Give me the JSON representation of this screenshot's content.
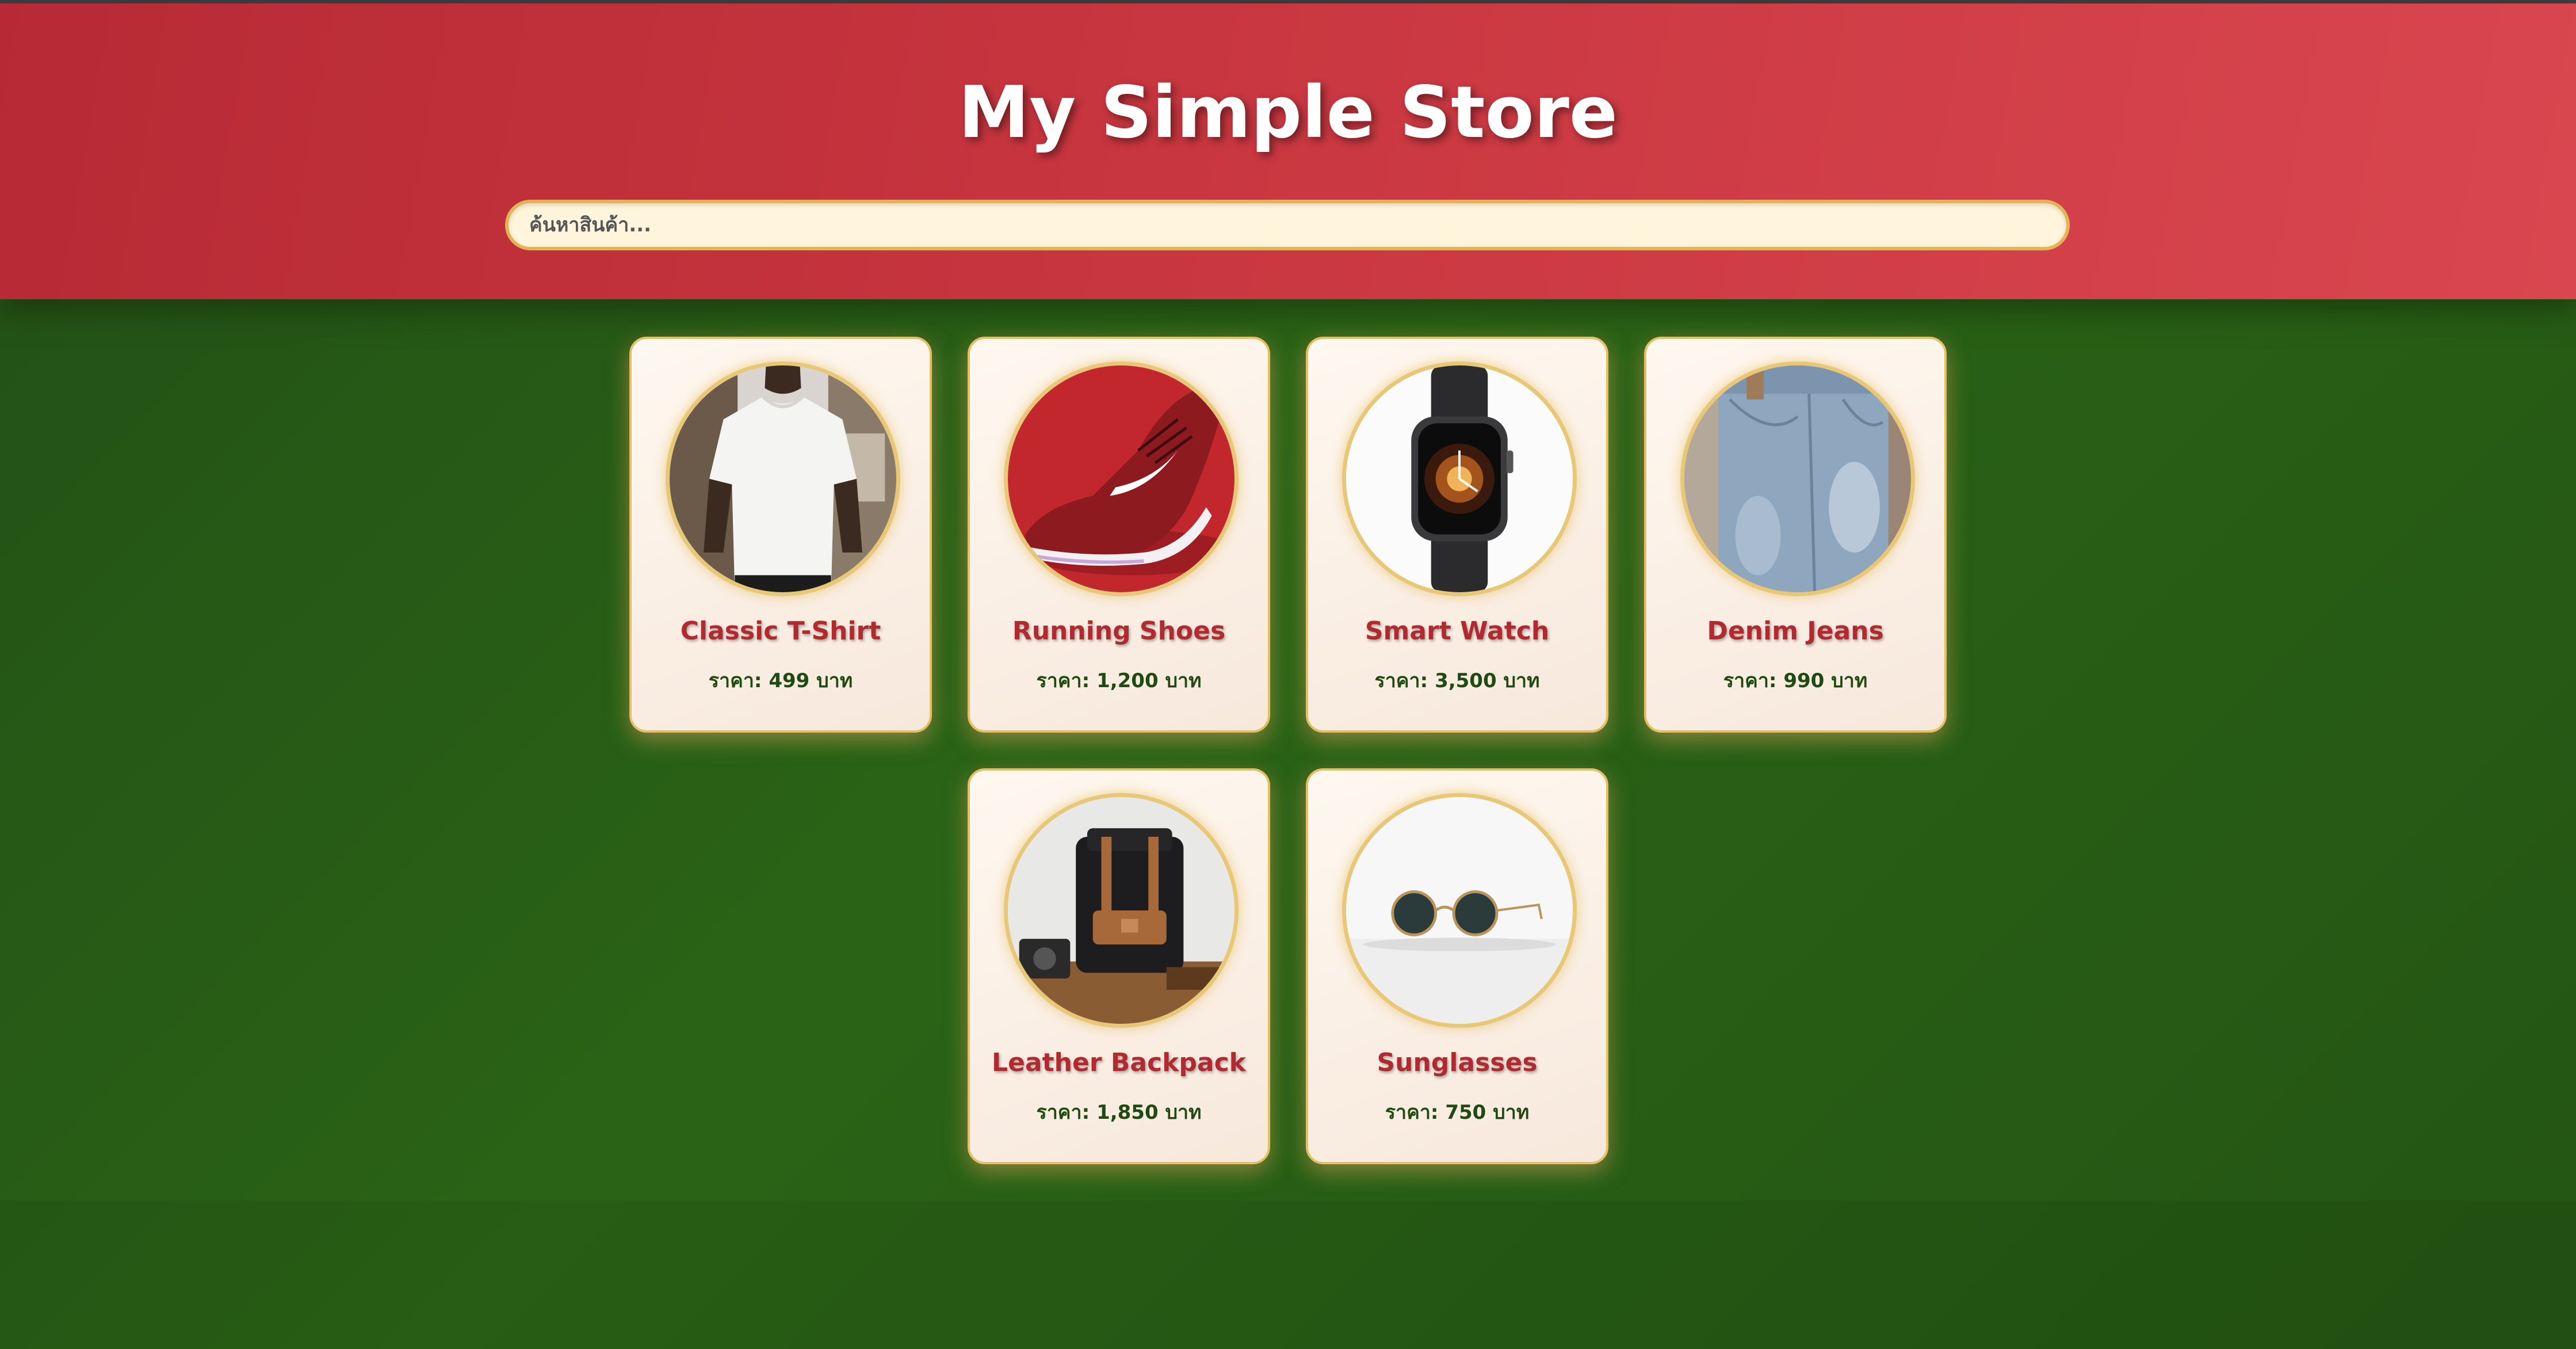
{
  "store": {
    "title": "My Simple Store",
    "search_placeholder": "ค้นหาสินค้า...",
    "search_value": ""
  },
  "colors": {
    "header": "#c8363f",
    "background": "#2a6316",
    "card_border": "#e6bf63",
    "product_name": "#b12a2f",
    "price": "#1f4a12"
  },
  "products": [
    {
      "name": "Classic T-Shirt",
      "price": "ราคา: 499 บาท",
      "image": "white-tshirt-photo"
    },
    {
      "name": "Running Shoes",
      "price": "ราคา: 1,200 บาท",
      "image": "red-running-shoe-photo"
    },
    {
      "name": "Smart Watch",
      "price": "ราคา: 3,500 บาท",
      "image": "smart-watch-photo"
    },
    {
      "name": "Denim Jeans",
      "price": "ราคา: 990 บาท",
      "image": "denim-jeans-photo"
    },
    {
      "name": "Leather Backpack",
      "price": "ราคา: 1,850 บาท",
      "image": "leather-backpack-photo"
    },
    {
      "name": "Sunglasses",
      "price": "ราคา: 750 บาท",
      "image": "sunglasses-photo"
    }
  ]
}
